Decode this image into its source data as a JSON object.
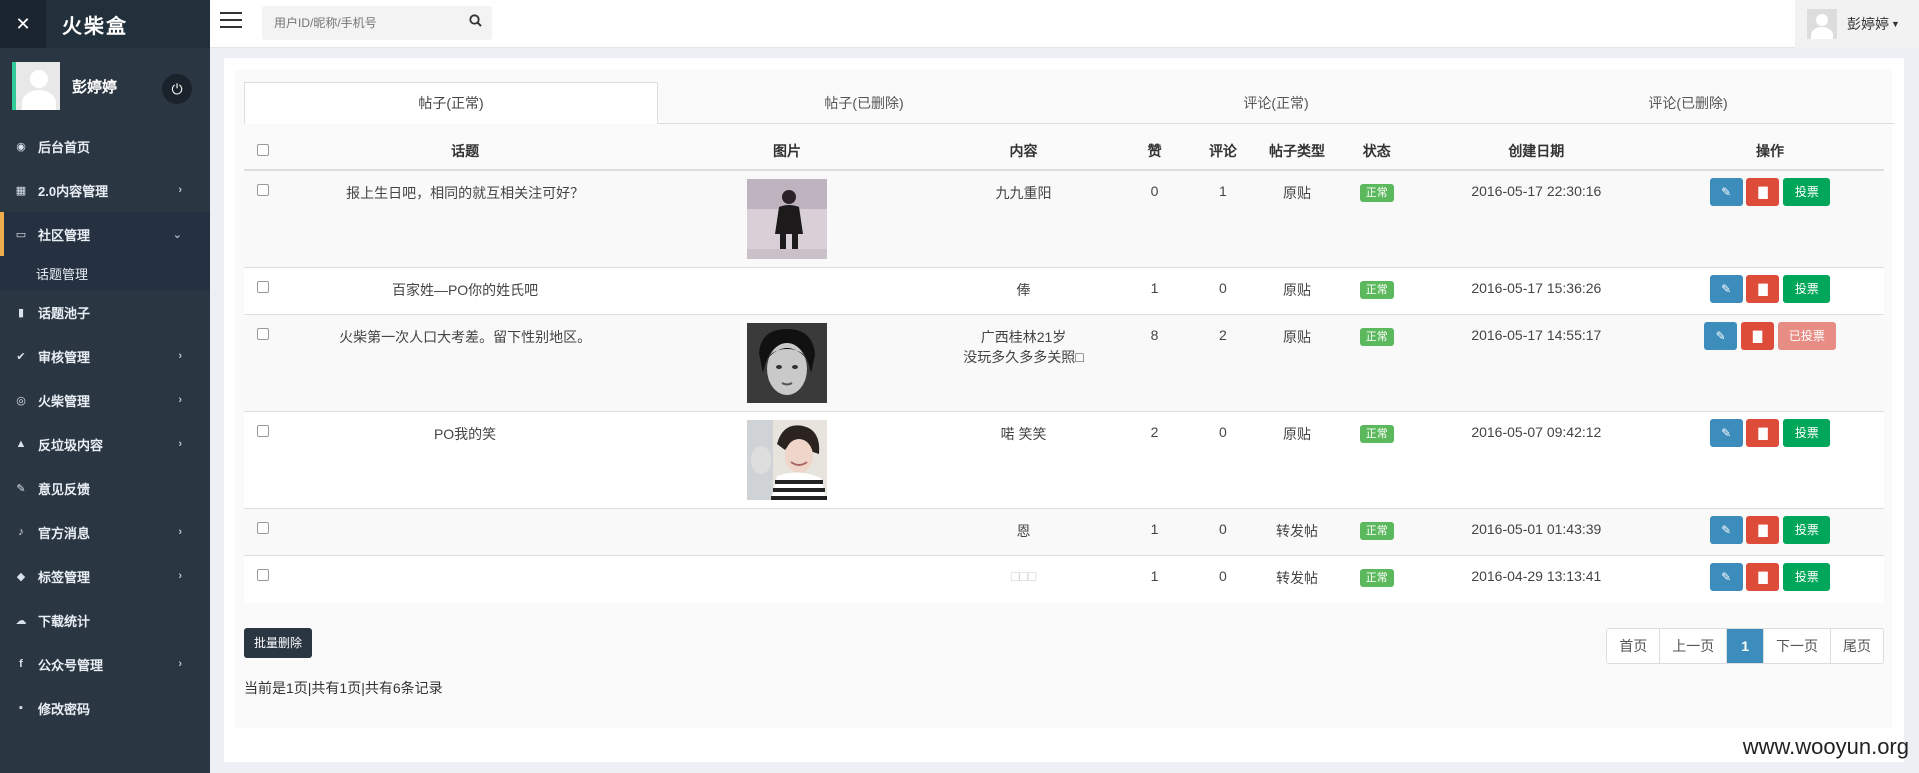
{
  "brand": {
    "logo": "✕",
    "name": "火柴盒"
  },
  "user": {
    "name": "彭婷婷"
  },
  "sidebar": {
    "items": [
      {
        "label": "后台首页",
        "icon": "dashboard-icon",
        "glyph": "◉",
        "chevron": ""
      },
      {
        "label": "2.0内容管理",
        "icon": "calendar-icon",
        "glyph": "▦",
        "chevron": "›"
      },
      {
        "label": "社区管理",
        "icon": "laptop-icon",
        "glyph": "▭",
        "chevron": "⌄"
      },
      {
        "label": "话题管理",
        "icon": "",
        "glyph": "",
        "chevron": ""
      },
      {
        "label": "话题池子",
        "icon": "book-icon",
        "glyph": "▮",
        "chevron": ""
      },
      {
        "label": "审核管理",
        "icon": "check-circle-icon",
        "glyph": "✔",
        "chevron": "›"
      },
      {
        "label": "火柴管理",
        "icon": "eye-icon",
        "glyph": "◎",
        "chevron": "›"
      },
      {
        "label": "反垃圾内容",
        "icon": "warning-icon",
        "glyph": "▲",
        "chevron": "›"
      },
      {
        "label": "意见反馈",
        "icon": "pencil-icon",
        "glyph": "✎",
        "chevron": ""
      },
      {
        "label": "官方消息",
        "icon": "bell-icon",
        "glyph": "♪",
        "chevron": "›"
      },
      {
        "label": "标签管理",
        "icon": "tags-icon",
        "glyph": "◆",
        "chevron": "›"
      },
      {
        "label": "下载统计",
        "icon": "cloud-download-icon",
        "glyph": "☁",
        "chevron": ""
      },
      {
        "label": "公众号管理",
        "icon": "facebook-icon",
        "glyph": "f",
        "chevron": "›"
      },
      {
        "label": "修改密码",
        "icon": "lock-icon",
        "glyph": "▪",
        "chevron": ""
      }
    ]
  },
  "search": {
    "placeholder": "用户ID/昵称/手机号"
  },
  "tabs": [
    "帖子(正常)",
    "帖子(已删除)",
    "评论(正常)",
    "评论(已删除)"
  ],
  "table": {
    "headers": [
      "话题",
      "图片",
      "内容",
      "赞",
      "评论",
      "帖子类型",
      "状态",
      "创建日期",
      "操作"
    ],
    "rows": [
      {
        "topic": "报上生日吧，相同的就互相关注可好？",
        "image": "photo-girl-standing",
        "content": "九九重阳",
        "likes": "0",
        "comments": "1",
        "type": "原贴",
        "status": "正常",
        "date": "2016-05-17 22:30:16",
        "vote": "投票"
      },
      {
        "topic": "百家姓—PO你的姓氏吧",
        "image": "",
        "content": "俸",
        "likes": "1",
        "comments": "0",
        "type": "原贴",
        "status": "正常",
        "date": "2016-05-17 15:36:26",
        "vote": "投票"
      },
      {
        "topic": "火柴第一次人口大考差。留下性别地区。",
        "image": "photo-portrait-bw",
        "content": "广西桂林21岁\n没玩多久多多关照□",
        "likes": "8",
        "comments": "2",
        "type": "原贴",
        "status": "正常",
        "date": "2016-05-17 14:55:17",
        "vote": "已投票"
      },
      {
        "topic": "PO我的笑",
        "image": "photo-girl-smiling",
        "content": "喏 笑笑",
        "likes": "2",
        "comments": "0",
        "type": "原贴",
        "status": "正常",
        "date": "2016-05-07 09:42:12",
        "vote": "投票"
      },
      {
        "topic": "",
        "image": "",
        "content": "恩",
        "likes": "1",
        "comments": "0",
        "type": "转发帖",
        "status": "正常",
        "date": "2016-05-01 01:43:39",
        "vote": "投票"
      },
      {
        "topic": "",
        "image": "",
        "content": "□□□",
        "likes": "1",
        "comments": "0",
        "type": "转发帖",
        "status": "正常",
        "date": "2016-04-29 13:13:41",
        "vote": "投票"
      }
    ]
  },
  "actions": {
    "batch_delete": "批量删除"
  },
  "pagination": {
    "first": "首页",
    "prev": "上一页",
    "current": "1",
    "next": "下一页",
    "last": "尾页"
  },
  "summary": "当前是1页|共有1页|共有6条记录",
  "watermark": "www.wooyun.org",
  "colors": {
    "sidebar": "#2b3643",
    "primary": "#3c8dbc",
    "danger": "#dd4b39",
    "success": "#00a65a",
    "badge": "#5cb85c",
    "active_accent": "#f0ad4e"
  }
}
